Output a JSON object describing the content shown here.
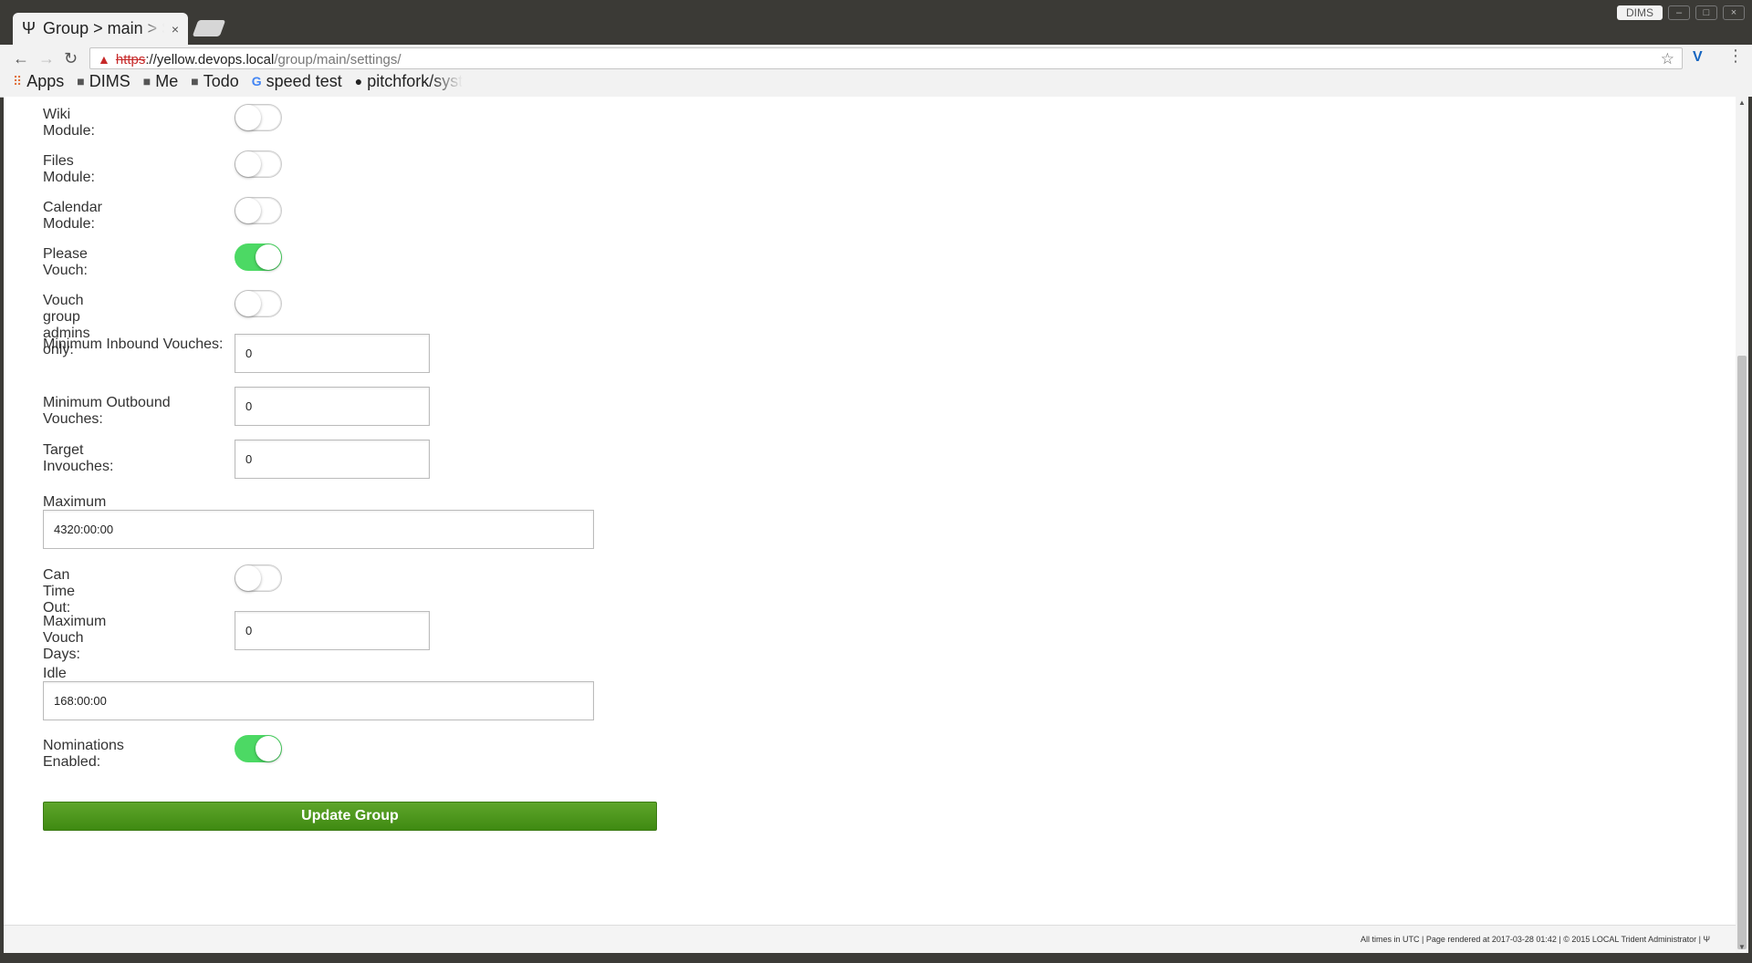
{
  "browser": {
    "tab_title": "Group > main > Settings",
    "tab_favicon": "Ψ",
    "tab_close": "×",
    "url": {
      "scheme": "https",
      "separator": "://",
      "host": "yellow.devops.local",
      "path": "/group/main/settings/"
    },
    "profile_name": "DIMS",
    "extension_label": "V",
    "bookmarks": [
      {
        "label": "Apps",
        "icon": "apps-grid-icon"
      },
      {
        "label": "DIMS",
        "icon": "folder-icon"
      },
      {
        "label": "Me",
        "icon": "folder-icon"
      },
      {
        "label": "Todo",
        "icon": "folder-icon"
      },
      {
        "label": "speed test",
        "icon": "google-icon"
      },
      {
        "label": "pitchfork/syst",
        "icon": "github-icon"
      }
    ]
  },
  "form": {
    "wiki_module": {
      "label": "Wiki Module:",
      "enabled": false
    },
    "files_module": {
      "label": "Files Module:",
      "enabled": false
    },
    "calendar_module": {
      "label": "Calendar Module:",
      "enabled": false
    },
    "please_vouch": {
      "label": "Please Vouch:",
      "enabled": true
    },
    "vouch_admins_only": {
      "label": "Vouch group admins only:",
      "enabled": false
    },
    "min_inbound_vouches": {
      "label": "Minimum Inbound Vouches:",
      "value": "0"
    },
    "min_outbound_vouches": {
      "label": "Minimum Outbound Vouches:",
      "value": "0"
    },
    "target_invouches": {
      "label": "Target Invouches:",
      "value": "0"
    },
    "max_inactivity": {
      "label": "Maximum Inactivity:",
      "value": "4320:00:00"
    },
    "can_time_out": {
      "label": "Can Time Out:",
      "enabled": false
    },
    "max_vouch_days": {
      "label": "Maximum Vouch Days:",
      "value": "0"
    },
    "idle_guard": {
      "label": "Idle Guard:",
      "value": "168:00:00"
    },
    "nominations_enabled": {
      "label": "Nominations Enabled:",
      "enabled": true
    },
    "submit_label": "Update Group"
  },
  "footer": {
    "text": "All times in UTC | Page rendered at 2017-03-28 01:42 | © 2015 LOCAL Trident Administrator | Ψ"
  },
  "colors": {
    "toggle_on": "#4cd964",
    "button_green": "#4a9a1c",
    "insecure_red": "#c62828"
  }
}
